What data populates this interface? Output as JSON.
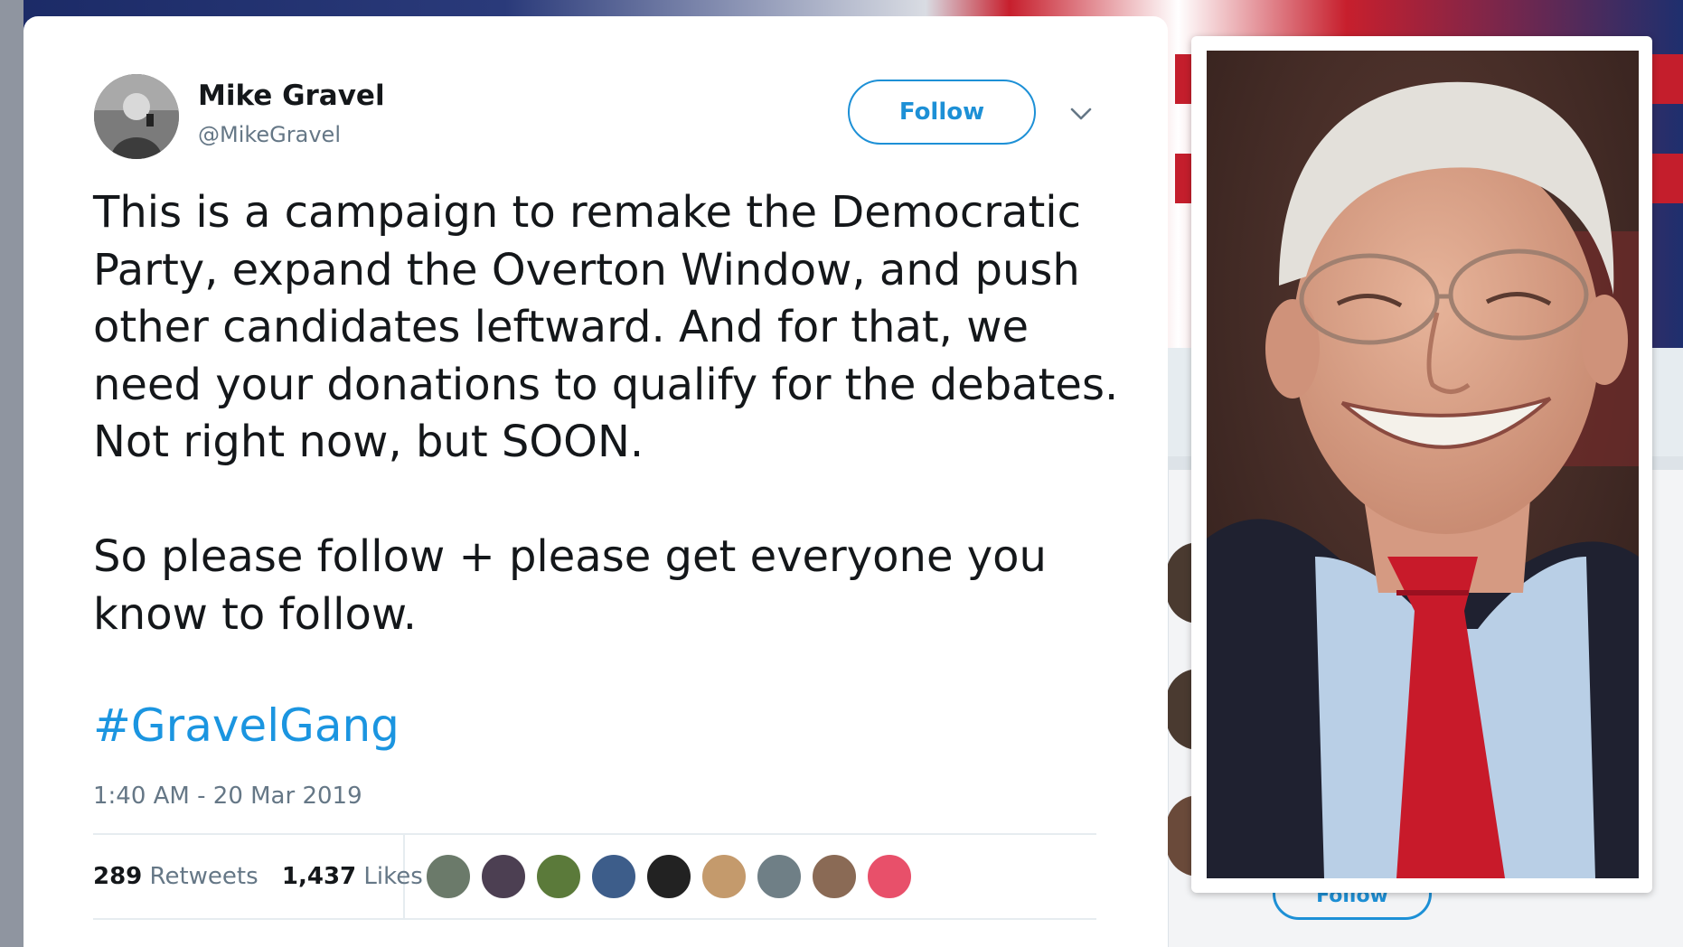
{
  "tweet": {
    "author_name": "Mike Gravel",
    "author_handle": "@MikeGravel",
    "follow_label": "Follow",
    "text_paragraph_1": "This is a campaign to remake the Democratic Party, expand the Overton Window, and push other candidates leftward. And for that, we need your donations to qualify for the debates. Not right now, but SOON.",
    "text_paragraph_2": "So please follow + please get everyone you know to follow.",
    "hashtag": "#GravelGang",
    "timestamp": "1:40 AM - 20 Mar 2019",
    "retweet_count": "289",
    "retweet_label": "Retweets",
    "like_count": "1,437",
    "like_label": "Likes",
    "liker_avatar_colors": [
      "#6b7a6a",
      "#4c3f52",
      "#5b7a3a",
      "#3d5d8a",
      "#222222",
      "#c49a6c",
      "#6f7f86",
      "#8a6a55",
      "#e8506a"
    ]
  },
  "sidebar": {
    "follow_label": "Follow"
  },
  "colors": {
    "accent": "#1d90d6",
    "hashtag": "#1b95e0",
    "secondary_text": "#657786"
  }
}
